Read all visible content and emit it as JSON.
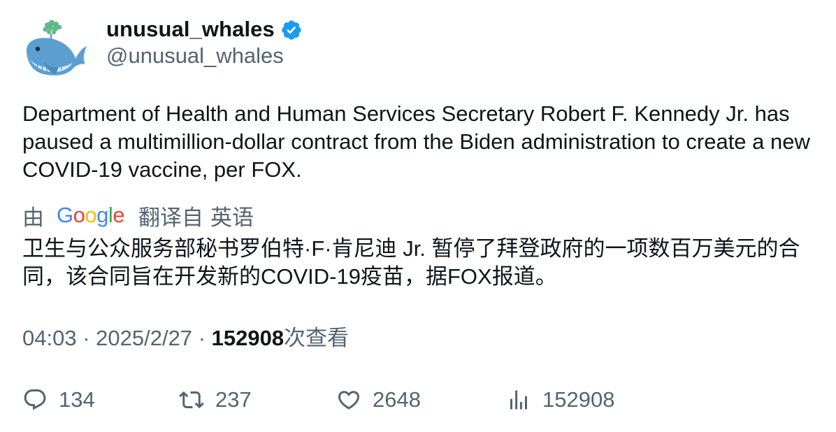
{
  "author": {
    "display_name": "unusual_whales",
    "handle": "@unusual_whales",
    "verified": true,
    "verified_color": "#1d9bf0",
    "avatar_icon": "whale-icon"
  },
  "tweet": {
    "text": "Department of Health and Human Services Secretary Robert F. Kennedy Jr. has paused a multimillion-dollar contract from the Biden administration to create a new COVID-19 vaccine, per FOX."
  },
  "translation": {
    "by_label": "由",
    "provider": "Google",
    "translated_from_label": "翻译自",
    "source_language": "英语",
    "text": "卫生与公众服务部秘书罗伯特·F·肯尼迪 Jr. 暂停了拜登政府的一项数百万美元的合同，该合同旨在开发新的COVID-19疫苗，据FOX报道。"
  },
  "meta": {
    "time": "04:03",
    "separator": "·",
    "date": "2025/2/27",
    "views_count": "152908",
    "views_label": "次查看"
  },
  "actions": {
    "reply_count": "134",
    "retweet_count": "237",
    "like_count": "2648",
    "views_count": "152908"
  },
  "colors": {
    "text_primary": "#0f1419",
    "text_secondary": "#536471",
    "google_blue": "#4285f4",
    "google_red": "#ea4335",
    "google_yellow": "#fbbc05",
    "google_green": "#34a853"
  }
}
